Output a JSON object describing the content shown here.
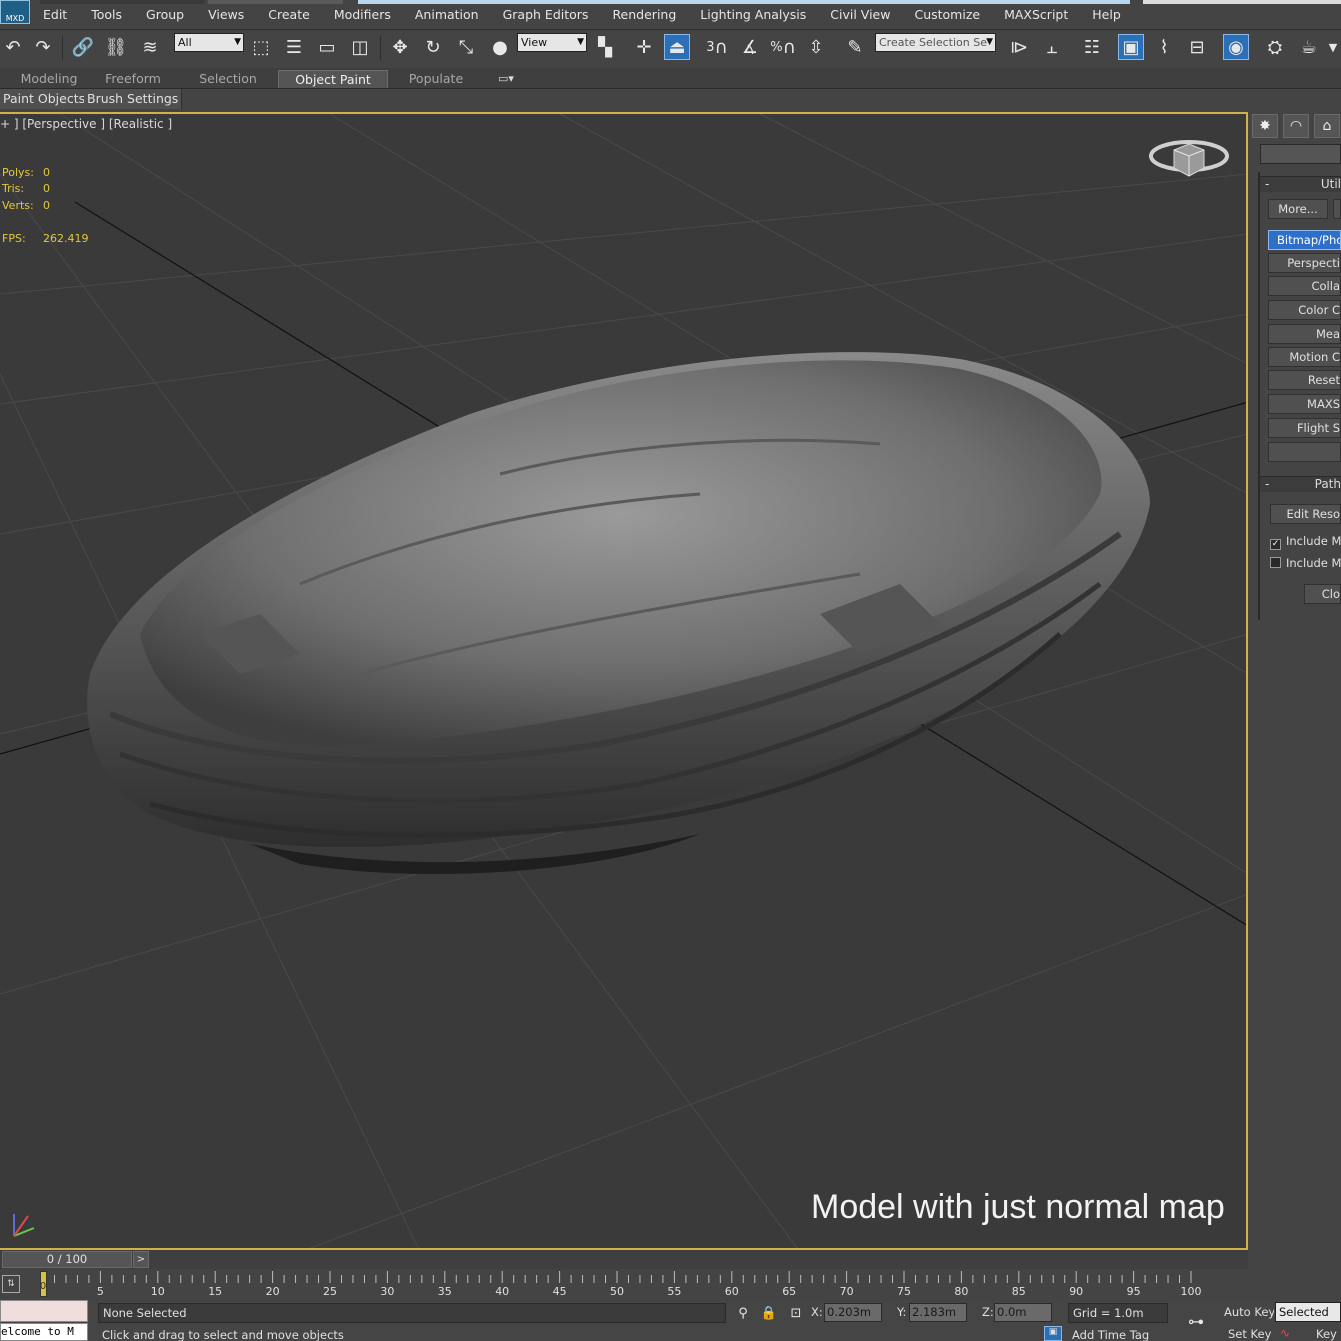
{
  "app": {
    "logo_text": "MXD"
  },
  "menu": [
    "Edit",
    "Tools",
    "Group",
    "Views",
    "Create",
    "Modifiers",
    "Animation",
    "Graph Editors",
    "Rendering",
    "Lighting Analysis",
    "Civil View",
    "Customize",
    "MAXScript",
    "Help"
  ],
  "toolbar": {
    "selection_filter": "All",
    "ref_coord": "View",
    "named_selection_placeholder": "Create Selection Se",
    "snap_label": "3",
    "angle_snap_label": "%"
  },
  "ribbon": {
    "tabs": [
      "Modeling",
      "Freeform",
      "Selection",
      "Object Paint",
      "Populate"
    ],
    "active": "Object Paint",
    "subtabs": [
      "Paint Objects",
      "Brush Settings"
    ]
  },
  "viewport": {
    "label": "+ ] [Perspective ] [Realistic ]",
    "stats": {
      "polys_label": "Polys:",
      "polys_value": "0",
      "tris_label": "Tris:",
      "tris_value": "0",
      "verts_label": "Verts:",
      "verts_value": "0",
      "fps_label": "FPS:",
      "fps_value": "262.419"
    },
    "caption": "Model with just normal map"
  },
  "command_panel": {
    "utilities_title": "Util",
    "more_button": "More...",
    "utility_buttons": [
      "Bitmap/Photo",
      "Perspecti",
      "Colla",
      "Color C",
      "Mea",
      "Motion C",
      "Reset",
      "MAXS",
      "Flight S",
      ""
    ],
    "path_title": "Path",
    "edit_button": "Edit Reso",
    "include_1": "Include Ma",
    "include_1_checked": true,
    "include_2": "Include Ma",
    "include_2_checked": false,
    "close_button": "Clo"
  },
  "timeline": {
    "frame_display": "0 / 100",
    "next_label": ">",
    "ticks": [
      "5",
      "10",
      "15",
      "20",
      "25",
      "30",
      "35",
      "40",
      "45",
      "50",
      "55",
      "60",
      "65",
      "70",
      "75",
      "80",
      "85",
      "90",
      "95",
      "100"
    ],
    "current_frame": "0"
  },
  "status": {
    "listener_text": "elcome to M",
    "selection_text": "None Selected",
    "prompt_text": "Click and drag to select and move objects",
    "x_label": "X:",
    "x_value": "0.203m",
    "y_label": "Y:",
    "y_value": "2.183m",
    "z_label": "Z:",
    "z_value": "0.0m",
    "grid_text": "Grid = 1.0m",
    "add_time_tag": "Add Time Tag",
    "auto_key": "Auto Key",
    "set_key": "Set Key",
    "key_mode": "Selected",
    "key_filters": "Key"
  },
  "colors": {
    "viewport_border": "#d2b04c",
    "stats_text": "#e4c83c",
    "active_button": "#2b6fb6"
  }
}
